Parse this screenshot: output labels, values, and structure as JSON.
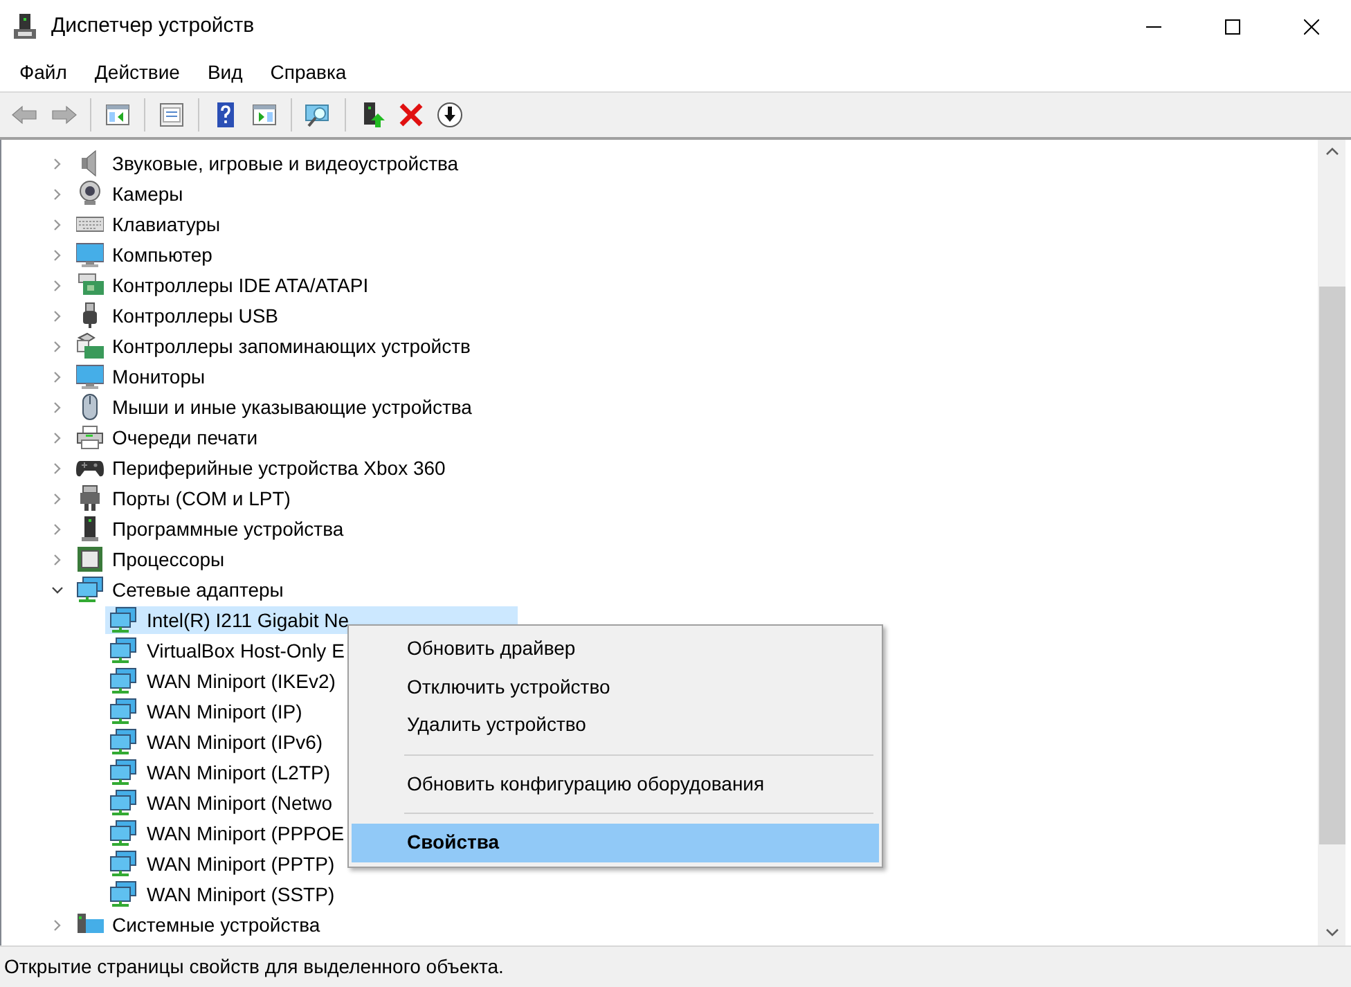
{
  "window": {
    "title": "Диспетчер устройств"
  },
  "menu_bar": [
    "Файл",
    "Действие",
    "Вид",
    "Справка"
  ],
  "toolbar": [
    {
      "kind": "back",
      "disabled": true
    },
    {
      "kind": "forward",
      "disabled": true
    },
    {
      "kind": "separator"
    },
    {
      "kind": "tree-pane"
    },
    {
      "kind": "separator"
    },
    {
      "kind": "properties"
    },
    {
      "kind": "separator"
    },
    {
      "kind": "help"
    },
    {
      "kind": "action-pane"
    },
    {
      "kind": "separator"
    },
    {
      "kind": "scan"
    },
    {
      "kind": "separator"
    },
    {
      "kind": "update"
    },
    {
      "kind": "remove"
    },
    {
      "kind": "download"
    }
  ],
  "tree": [
    {
      "label": "Звуковые, игровые и видеоустройства",
      "kind": "sound",
      "expanded": false
    },
    {
      "label": "Камеры",
      "kind": "camera",
      "expanded": false
    },
    {
      "label": "Клавиатуры",
      "kind": "keyboard",
      "expanded": false
    },
    {
      "label": "Компьютер",
      "kind": "monitor",
      "expanded": false
    },
    {
      "label": "Контроллеры IDE ATA/ATAPI",
      "kind": "ide",
      "expanded": false
    },
    {
      "label": "Контроллеры USB",
      "kind": "usb",
      "expanded": false
    },
    {
      "label": "Контроллеры запоминающих устройств",
      "kind": "storage",
      "expanded": false
    },
    {
      "label": "Мониторы",
      "kind": "monitor",
      "expanded": false
    },
    {
      "label": "Мыши и иные указывающие устройства",
      "kind": "mouse",
      "expanded": false
    },
    {
      "label": "Очереди печати",
      "kind": "printer",
      "expanded": false
    },
    {
      "label": "Периферийные устройства Xbox 360",
      "kind": "gamepad",
      "expanded": false
    },
    {
      "label": "Порты (COM и LPT)",
      "kind": "port",
      "expanded": false
    },
    {
      "label": "Программные устройства",
      "kind": "software",
      "expanded": false
    },
    {
      "label": "Процессоры",
      "kind": "cpu",
      "expanded": false
    },
    {
      "label": "Сетевые адаптеры",
      "kind": "network",
      "expanded": true,
      "children": [
        {
          "label": "Intel(R) I211 Gigabit Ne",
          "kind": "network",
          "selected": true
        },
        {
          "label": "VirtualBox Host-Only E",
          "kind": "network",
          "selected": false
        },
        {
          "label": "WAN Miniport (IKEv2)",
          "kind": "network",
          "selected": false
        },
        {
          "label": "WAN Miniport (IP)",
          "kind": "network",
          "selected": false
        },
        {
          "label": "WAN Miniport (IPv6)",
          "kind": "network",
          "selected": false
        },
        {
          "label": "WAN Miniport (L2TP)",
          "kind": "network",
          "selected": false
        },
        {
          "label": "WAN Miniport (Netwo",
          "kind": "network",
          "selected": false
        },
        {
          "label": "WAN Miniport (PPPOE",
          "kind": "network",
          "selected": false
        },
        {
          "label": "WAN Miniport (PPTP)",
          "kind": "network",
          "selected": false
        },
        {
          "label": "WAN Miniport (SSTP)",
          "kind": "network",
          "selected": false
        }
      ]
    },
    {
      "label": "Системные устройства",
      "kind": "system",
      "expanded": false
    }
  ],
  "context_menu": [
    {
      "kind": "item",
      "label": "Обновить драйвер",
      "selected": false
    },
    {
      "kind": "item",
      "label": "Отключить устройство",
      "selected": false
    },
    {
      "kind": "item",
      "label": "Удалить устройство",
      "selected": false
    },
    {
      "kind": "separator"
    },
    {
      "kind": "item",
      "label": "Обновить конфигурацию оборудования",
      "selected": false
    },
    {
      "kind": "separator"
    },
    {
      "kind": "item",
      "label": "Свойства",
      "selected": true
    }
  ],
  "status_bar": {
    "text": "Открытие страницы свойств для выделенного объекта."
  }
}
